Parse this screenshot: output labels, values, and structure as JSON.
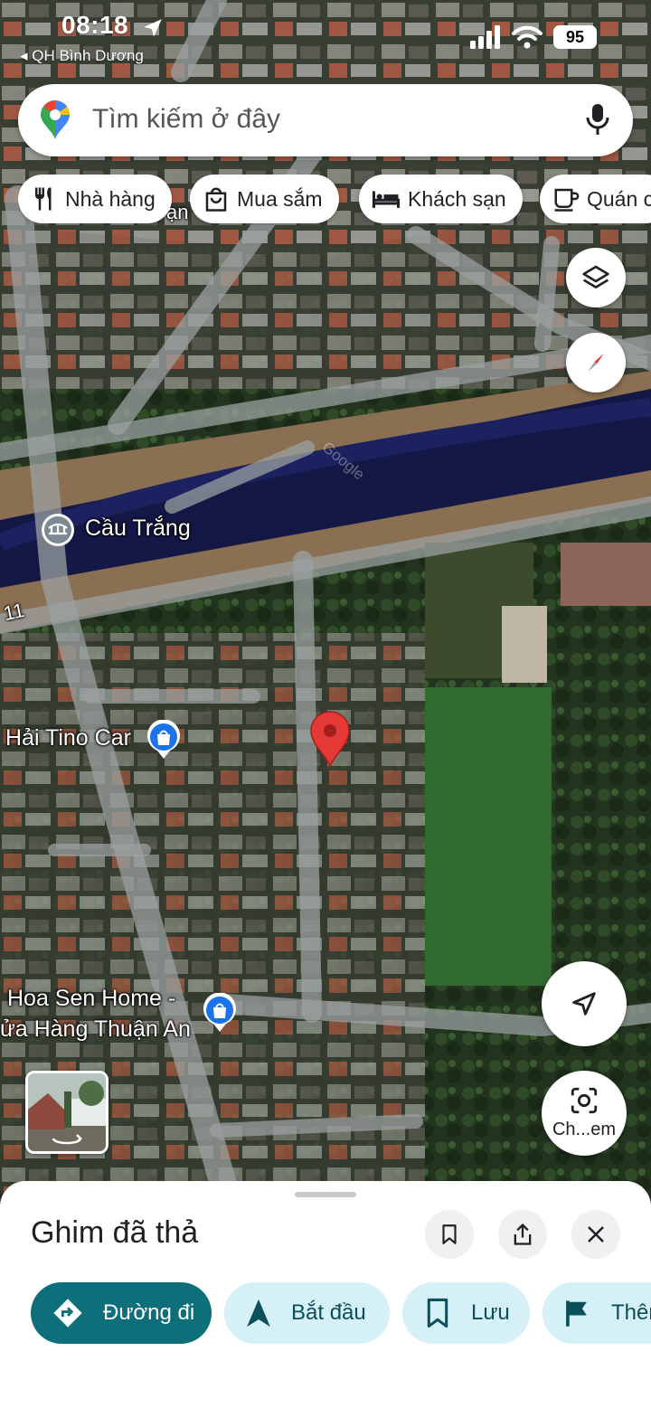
{
  "status_bar": {
    "time": "08:18",
    "back_label": "◂ QH Bình Dương",
    "battery": "95"
  },
  "search": {
    "placeholder": "Tìm kiếm ở đây"
  },
  "categories": [
    {
      "label": "Nhà hàng",
      "icon": "restaurant-icon"
    },
    {
      "label": "Mua sắm",
      "icon": "shopping-bag-icon"
    },
    {
      "label": "Khách sạn",
      "icon": "hotel-bed-icon"
    },
    {
      "label": "Quán c",
      "icon": "coffee-icon"
    }
  ],
  "map": {
    "labels": {
      "bridge": "Cầu Trắng",
      "road_number": "11",
      "shop1": "Hải Tino Car",
      "shop2_line1": "Hoa Sen Home -",
      "shop2_line2": "ửa Hàng Thuận An",
      "partial_top": "ạn"
    },
    "watermark": "Google",
    "lens_label": "Ch...em"
  },
  "sheet": {
    "title": "Ghim đã thả",
    "actions": [
      {
        "label": "Đường đi",
        "icon": "directions-icon",
        "primary": true
      },
      {
        "label": "Bắt đầu",
        "icon": "navigate-arrow-icon"
      },
      {
        "label": "Lưu",
        "icon": "bookmark-icon"
      },
      {
        "label": "Thêm",
        "icon": "flag-icon"
      }
    ]
  },
  "colors": {
    "accent": "#0e6f7a",
    "chip_light": "#d6f0f7",
    "pin_red": "#e53935",
    "river": "#141845"
  }
}
